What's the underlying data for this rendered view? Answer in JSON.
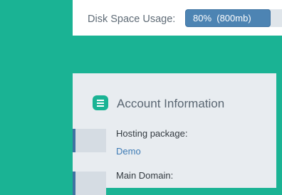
{
  "disk": {
    "label": "Disk Space Usage:",
    "usage_text": "80%  (800mb)",
    "percent": 80,
    "fill_color": "#4d84b3"
  },
  "account": {
    "icon": "list-icon",
    "title": "Account Information",
    "rows": [
      {
        "label": "Hosting package:",
        "value": "Demo"
      },
      {
        "label": "Main Domain:",
        "value": ""
      }
    ]
  },
  "colors": {
    "background": "#1ab394",
    "accent": "#3e73a2",
    "link": "#3e7bb5"
  }
}
